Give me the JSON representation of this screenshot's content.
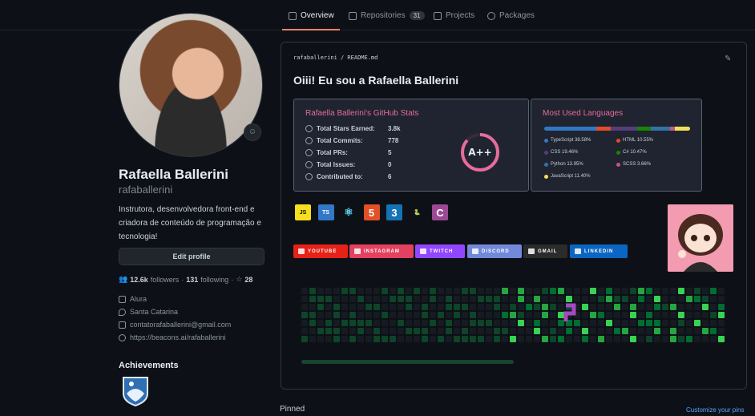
{
  "nav": {
    "tabs": [
      {
        "label": "Overview"
      },
      {
        "label": "Repositories",
        "count": "31"
      },
      {
        "label": "Projects"
      },
      {
        "label": "Packages"
      }
    ]
  },
  "profile": {
    "name": "Rafaella Ballerini",
    "login": "rafaballerini",
    "bio": "Instrutora, desenvolvedora front-end e criadora de conteúdo de programação e tecnologia!",
    "edit_label": "Edit profile",
    "followers_count": "12.6k",
    "followers_label": "followers",
    "following_count": "131",
    "following_label": "following",
    "stars_count": "28",
    "company": "Alura",
    "location": "Santa Catarina",
    "email": "contatorafaballerini@gmail.com",
    "website": "https://beacons.ai/rafaballerini",
    "achievements_title": "Achievements"
  },
  "readme": {
    "path": "rafaballerini / README.md",
    "heading": "Oiii! Eu sou a Rafaella Ballerini"
  },
  "stats_card": {
    "title": "Rafaella Ballerini's GitHub Stats",
    "rows": [
      {
        "label": "Total Stars Earned:",
        "value": "3.8k"
      },
      {
        "label": "Total Commits:",
        "value": "778"
      },
      {
        "label": "Total PRs:",
        "value": "5"
      },
      {
        "label": "Total Issues:",
        "value": "0"
      },
      {
        "label": "Contributed to:",
        "value": "6"
      }
    ],
    "grade": "A++",
    "ring_color": "#e66c9c"
  },
  "langs_card": {
    "title": "Most Used Languages",
    "languages": [
      {
        "name": "TypeScript 38.58%",
        "percent": 38.58,
        "color": "#3178c6"
      },
      {
        "name": "HTML 10.55%",
        "percent": 10.55,
        "color": "#e34c26"
      },
      {
        "name": "CSS 19.46%",
        "percent": 19.46,
        "color": "#563d7c"
      },
      {
        "name": "C# 10.47%",
        "percent": 10.47,
        "color": "#178600"
      },
      {
        "name": "Python 13.95%",
        "percent": 13.95,
        "color": "#3572a5"
      },
      {
        "name": "SCSS 3.66%",
        "percent": 3.66,
        "color": "#c6538c"
      },
      {
        "name": "JavaScript 11.40%",
        "percent": 11.4,
        "color": "#f1e05a"
      }
    ]
  },
  "tech_icons": [
    {
      "name": "javascript-icon",
      "glyph": "JS",
      "bg": "#f7df1e",
      "fg": "#000000"
    },
    {
      "name": "typescript-icon",
      "glyph": "TS",
      "bg": "#3178c6",
      "fg": "#ffffff"
    },
    {
      "name": "react-icon",
      "glyph": "⚛",
      "bg": "transparent",
      "fg": "#61dafb"
    },
    {
      "name": "html5-icon",
      "glyph": "5",
      "bg": "#e34f26",
      "fg": "#ffffff"
    },
    {
      "name": "css3-icon",
      "glyph": "3",
      "bg": "#1572b6",
      "fg": "#ffffff"
    },
    {
      "name": "python-icon",
      "glyph": "🐍",
      "bg": "transparent",
      "fg": "#ffd43b"
    },
    {
      "name": "csharp-icon",
      "glyph": "C",
      "bg": "#9b4993",
      "fg": "#ffffff"
    }
  ],
  "socials": [
    {
      "label": "YOUTUBE",
      "color": "#e62117"
    },
    {
      "label": "INSTAGRAM",
      "color": "#e4405f"
    },
    {
      "label": "TWITCH",
      "color": "#9146ff"
    },
    {
      "label": "DISCORD",
      "color": "#7289da"
    },
    {
      "label": "GMAIL",
      "color": "#2b2b2b"
    },
    {
      "label": "LINKEDIN",
      "color": "#0a66c2"
    }
  ],
  "footer": {
    "pinned": "Pinned",
    "customize": "Customize your pins"
  }
}
